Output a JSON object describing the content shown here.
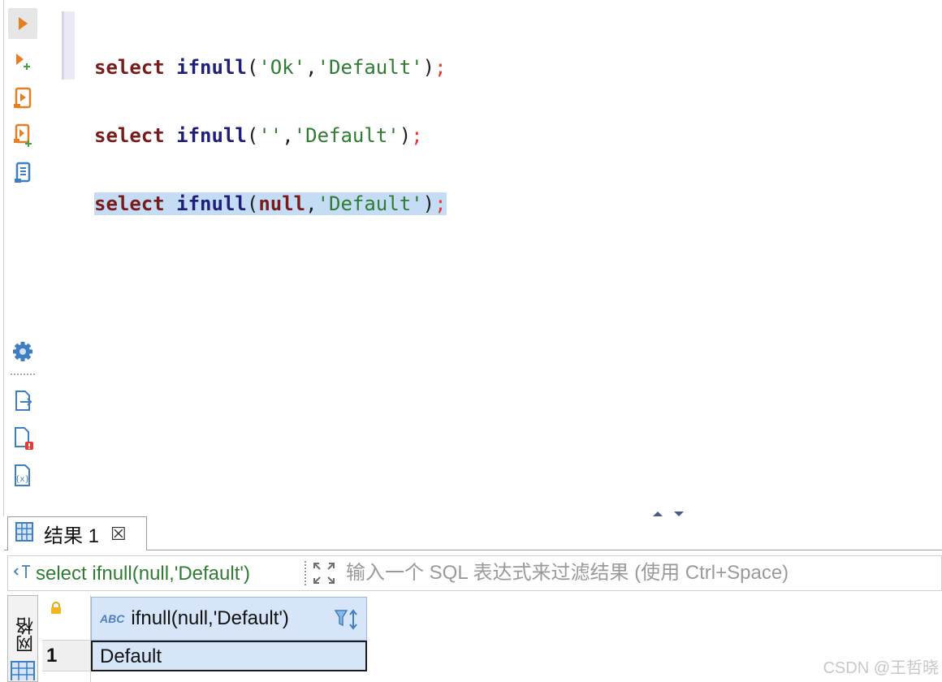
{
  "editor": {
    "lines": [
      {
        "kw": "select",
        "fn": "ifnull",
        "open": "(",
        "arg1": "'Ok'",
        "comma": ",",
        "arg2": "'Default'",
        "close": ")",
        "semi": ";"
      },
      {
        "kw": "select",
        "fn": "ifnull",
        "open": "(",
        "arg1": "''",
        "comma": ",",
        "arg2": "'Default'",
        "close": ")",
        "semi": ";"
      },
      {
        "kw": "select",
        "fn": "ifnull",
        "open": "(",
        "arg1": "null",
        "comma": ",",
        "arg2": "'Default'",
        "close": ")",
        "semi": ";"
      }
    ]
  },
  "toolbar": {
    "icons": [
      "execute-statement-icon",
      "execute-new-tab-icon",
      "execute-script-icon",
      "execute-script-new-tab-icon",
      "explain-plan-icon",
      "settings-icon",
      "export-icon",
      "problems-icon",
      "variables-icon"
    ]
  },
  "results": {
    "tab_label": "结果 1",
    "tab_close": "☒",
    "query_text": "select ifnull(null,'Default')",
    "filter_placeholder": "输入一个 SQL 表达式来过滤结果 (使用 Ctrl+Space)",
    "vertical_tab": "网格",
    "column": {
      "type_label": "ABC",
      "name": "ifnull(null,'Default')"
    },
    "rows": [
      {
        "num": "1",
        "value": "Default"
      }
    ]
  },
  "watermark": "CSDN @王哲晓",
  "colors": {
    "keyword": "#7a1b1b",
    "function": "#1f1f7a",
    "string": "#2e7d32",
    "semicolon": "#e53935",
    "selection": "#c5dcf5",
    "accent": "#e67e22"
  }
}
